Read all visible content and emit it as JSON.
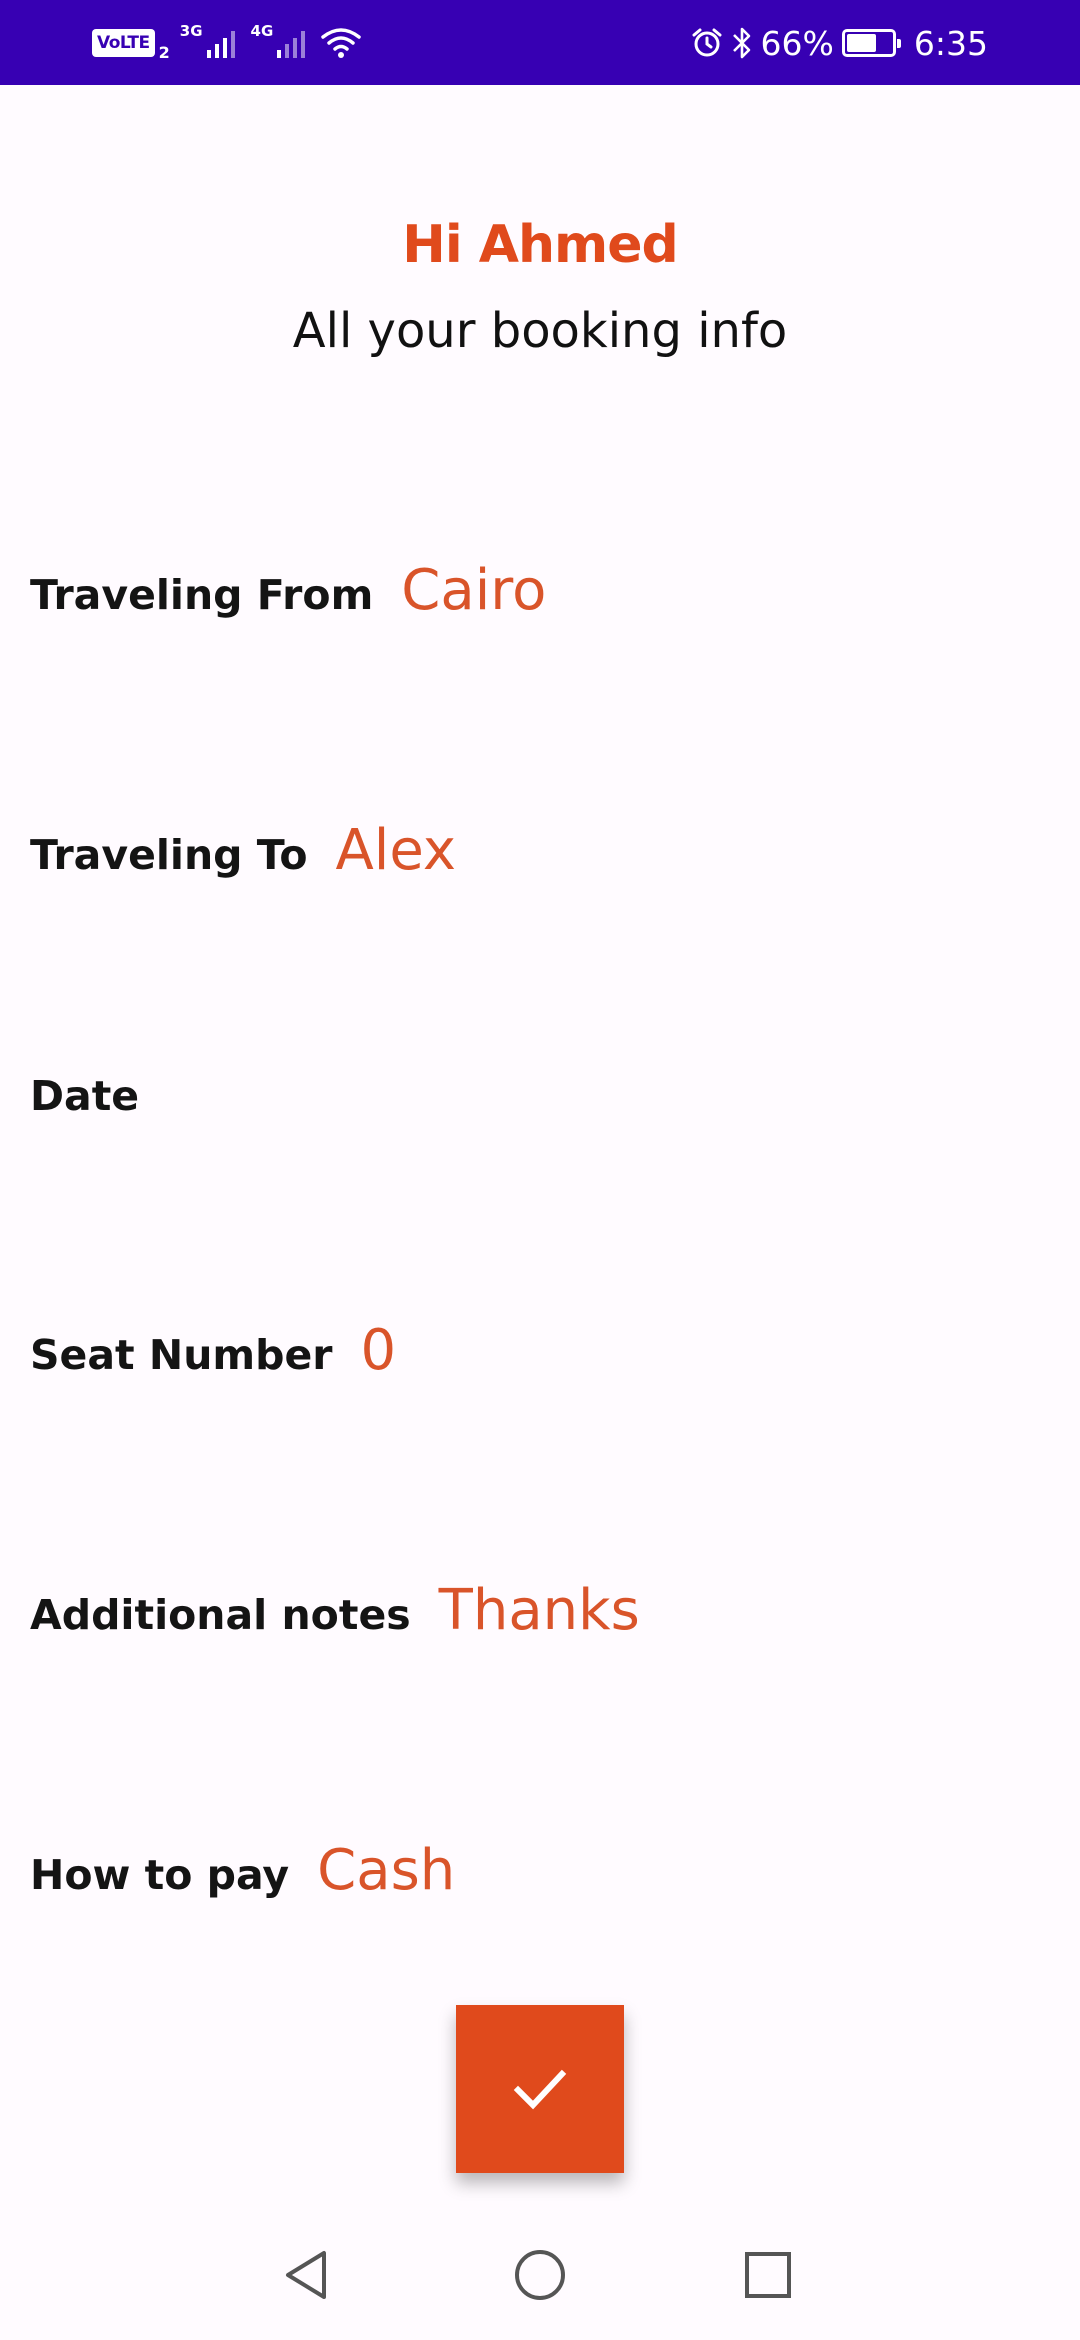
{
  "status_bar": {
    "volte": "VoLTE",
    "sim": "2",
    "net1": "3G",
    "net2": "4G",
    "battery_percent": "66%",
    "battery_level": 0.66,
    "time": "6:35",
    "icons": [
      "signal-icon",
      "wifi-icon",
      "alarm-icon",
      "bluetooth-icon",
      "battery-icon"
    ]
  },
  "header": {
    "greeting": "Hi Ahmed",
    "subtitle": "All your booking info"
  },
  "fields": {
    "from": {
      "label": "Traveling From",
      "value": "Cairo"
    },
    "to": {
      "label": "Traveling To",
      "value": "Alex"
    },
    "date": {
      "label": "Date",
      "value": ""
    },
    "seat": {
      "label": "Seat Number",
      "value": "0"
    },
    "notes": {
      "label": "Additional notes",
      "value": "Thanks"
    },
    "pay": {
      "label": "How to pay",
      "value": "Cash"
    }
  },
  "fab": {
    "icon": "check-icon"
  },
  "nav": {
    "icons": [
      "back-icon",
      "home-icon",
      "recents-icon"
    ]
  },
  "colors": {
    "status_bar": "#3700b3",
    "accent": "#e04a1c",
    "value_text": "#d9542a",
    "background": "#fffbff"
  }
}
